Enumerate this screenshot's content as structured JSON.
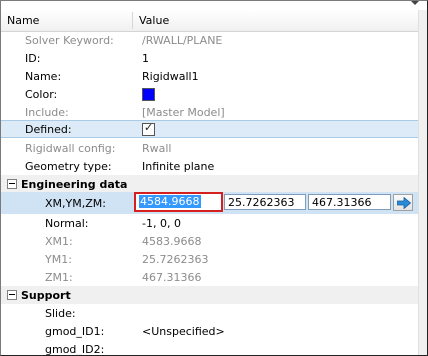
{
  "columns": {
    "name": "Name",
    "value": "Value"
  },
  "rows_top": [
    {
      "label": "Solver Keyword:",
      "value": "/RWALL/PLANE",
      "gray": true
    },
    {
      "label": "ID:",
      "value": "1",
      "gray": false
    },
    {
      "label": "Name:",
      "value": "Rigidwall1",
      "gray": false
    },
    {
      "label": "Color:",
      "value": "",
      "gray": false
    },
    {
      "label": "Include:",
      "value": "[Master Model]",
      "gray": true
    },
    {
      "label": "Defined:",
      "value": "",
      "gray": false
    },
    {
      "label": "Rigidwall config:",
      "value": "Rwall",
      "gray": true
    },
    {
      "label": "Geometry type:",
      "value": "Infinite plane",
      "gray": false
    }
  ],
  "color_value": "#0000ff",
  "defined_checked": true,
  "sections": {
    "engineering": "Engineering data",
    "support": "Support"
  },
  "xm_row": {
    "label": "XM,YM,ZM:",
    "x": "4584.9668",
    "y": "25.7262363",
    "z": "467.31366",
    "pick_icon": "blue-arrow-icon"
  },
  "rows_eng": [
    {
      "label": "Normal:",
      "value": "-1, 0, 0",
      "gray": false
    },
    {
      "label": "XM1:",
      "value": "4583.9668",
      "gray": true
    },
    {
      "label": "YM1:",
      "value": "25.7262363",
      "gray": true
    },
    {
      "label": "ZM1:",
      "value": "467.31366",
      "gray": true
    }
  ],
  "rows_support": [
    {
      "label": "Slide:",
      "value": "",
      "gray": false
    },
    {
      "label": "gmod_ID1:",
      "value": "<Unspecified>",
      "gray": false
    },
    {
      "label": "gmod_ID2:",
      "value": "",
      "gray": false
    }
  ]
}
